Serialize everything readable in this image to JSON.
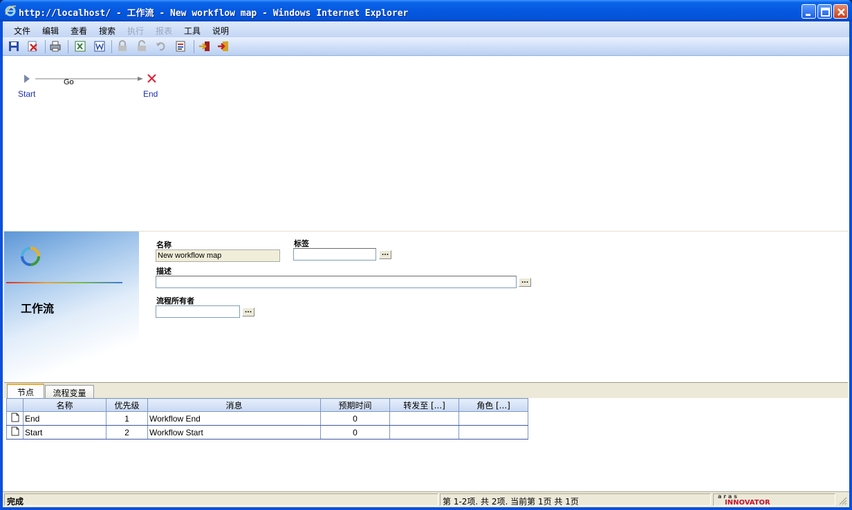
{
  "window": {
    "title": "http://localhost/ - 工作流 - New workflow map - Windows Internet Explorer"
  },
  "menu": {
    "items": [
      {
        "label": "文件",
        "enabled": true
      },
      {
        "label": "编辑",
        "enabled": true
      },
      {
        "label": "查看",
        "enabled": true
      },
      {
        "label": "搜索",
        "enabled": true
      },
      {
        "label": "执行",
        "enabled": false
      },
      {
        "label": "报表",
        "enabled": false
      },
      {
        "label": "工具",
        "enabled": true
      },
      {
        "label": "说明",
        "enabled": true
      }
    ]
  },
  "toolbar": {
    "buttons": [
      "save-icon",
      "close-item-icon",
      "print-icon",
      "export-excel-icon",
      "export-word-icon",
      "lock-icon",
      "unlock-icon",
      "undo-icon",
      "report-icon",
      "promote-icon",
      "exit-icon"
    ]
  },
  "workflow": {
    "start_label": "Start",
    "end_label": "End",
    "path_label": "Go"
  },
  "form": {
    "type_title": "工作流",
    "name_label": "名称",
    "name_value": "New workflow map",
    "label_label": "标签",
    "label_value": "",
    "description_label": "描述",
    "description_value": "",
    "owner_label": "流程所有者",
    "owner_value": "",
    "ellipsis": "..."
  },
  "tabs": [
    {
      "label": "节点",
      "active": true
    },
    {
      "label": "流程变量",
      "active": false
    }
  ],
  "grid": {
    "columns": [
      "名称",
      "优先级",
      "消息",
      "预期时间",
      "转发至 [...]",
      "角色 [...]"
    ],
    "rows": [
      {
        "name": "End",
        "priority": "1",
        "message": "Workflow End",
        "expected": "0",
        "escalate": "",
        "role": ""
      },
      {
        "name": "Start",
        "priority": "2",
        "message": "Workflow Start",
        "expected": "0",
        "escalate": "",
        "role": ""
      }
    ]
  },
  "status": {
    "left": "完成",
    "paging": "第 1-2项. 共 2项. 当前第 1页 共 1页",
    "logo_top": "a r a s",
    "logo_bottom": "INNOVATOR"
  },
  "colors": {
    "title_bar": "#0558e0",
    "node_label": "#1a2fb0",
    "end_marker": "#e0243a",
    "logo_red": "#c8102e"
  }
}
